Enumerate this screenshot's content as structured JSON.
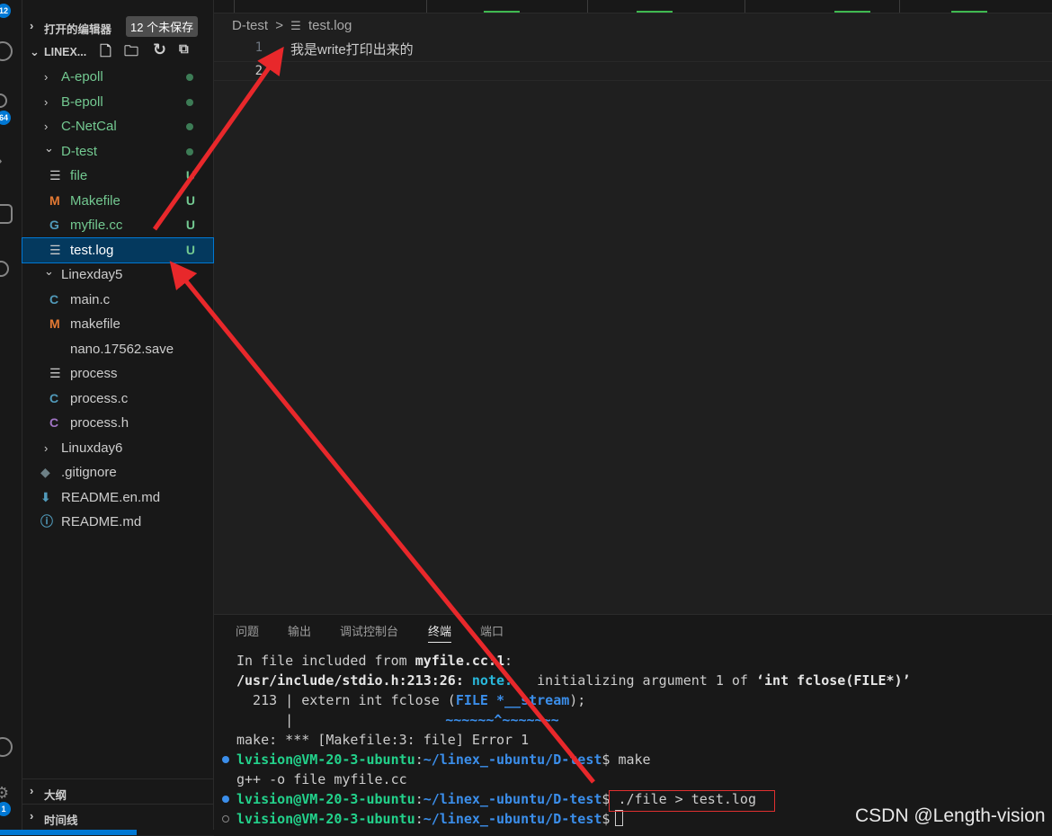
{
  "activity_bar": {
    "badges": [
      "12",
      "64",
      "1"
    ],
    "icons": [
      "files-icon",
      "search-icon",
      "source-control-icon",
      "run-debug-icon",
      "remote-explorer-icon",
      "extensions-icon",
      "account-icon",
      "settings-gear-icon"
    ]
  },
  "sidebar": {
    "open_editors_label": "打开的编辑器",
    "unsaved_badge": "12 个未保存",
    "workspace_label": "LINEX...",
    "tree": [
      {
        "label": "A-epoll",
        "kind": "folder",
        "state": "collapsed",
        "indent": 1,
        "dot": true
      },
      {
        "label": "B-epoll",
        "kind": "folder",
        "state": "collapsed",
        "indent": 1,
        "dot": true
      },
      {
        "label": "C-NetCal",
        "kind": "folder",
        "state": "collapsed",
        "indent": 1,
        "dot": true
      },
      {
        "label": "D-test",
        "kind": "folder",
        "state": "expanded",
        "indent": 1,
        "dot": true
      },
      {
        "label": "file",
        "kind": "file",
        "icon": "lines",
        "indent": 2,
        "status": "U"
      },
      {
        "label": "Makefile",
        "kind": "file",
        "icon": "M",
        "indent": 2,
        "status": "U"
      },
      {
        "label": "myfile.cc",
        "kind": "file",
        "icon": "C++",
        "indent": 2,
        "status": "U"
      },
      {
        "label": "test.log",
        "kind": "file",
        "icon": "lines",
        "indent": 2,
        "status": "U",
        "selected": true
      },
      {
        "label": "Linexday5",
        "kind": "folder",
        "state": "expanded",
        "indent": 1
      },
      {
        "label": "main.c",
        "kind": "file",
        "icon": "C",
        "indent": 2
      },
      {
        "label": "makefile",
        "kind": "file",
        "icon": "M",
        "indent": 2
      },
      {
        "label": "nano.17562.save",
        "kind": "file",
        "icon": "none",
        "indent": 2
      },
      {
        "label": "process",
        "kind": "file",
        "icon": "lines",
        "indent": 2
      },
      {
        "label": "process.c",
        "kind": "file",
        "icon": "C",
        "indent": 2
      },
      {
        "label": "process.h",
        "kind": "file",
        "icon": "H",
        "indent": 2
      },
      {
        "label": "Linuxday6",
        "kind": "folder",
        "state": "collapsed",
        "indent": 1
      },
      {
        "label": ".gitignore",
        "kind": "file",
        "icon": "git",
        "indent": 1
      },
      {
        "label": "README.en.md",
        "kind": "file",
        "icon": "download",
        "indent": 1
      },
      {
        "label": "README.md",
        "kind": "file",
        "icon": "info",
        "indent": 1
      }
    ],
    "outline_label": "大纲",
    "timeline_label": "时间线"
  },
  "editor": {
    "breadcrumb": {
      "folder": "D-test",
      "separator": ">",
      "file": "test.log"
    },
    "lines": [
      {
        "number": "1",
        "text": "我是write打印出来的"
      },
      {
        "number": "2",
        "text": ""
      }
    ]
  },
  "panel": {
    "tabs": [
      "问题",
      "输出",
      "调试控制台",
      "终端",
      "端口"
    ],
    "active_tab": "终端",
    "terminal": {
      "l1_pre": "In file included from ",
      "l1_bold": "myfile.cc:1",
      "l1_post": ":",
      "l2_loc": "/usr/include/stdio.h:213:26: ",
      "l2_note": "note: ",
      "l2_text": "  initializing argument 1 of ",
      "l2_sig": "‘int fclose(FILE*)’",
      "l3_pre": "  213 | extern int fclose (",
      "l3_hl": "FILE *__stream",
      "l3_post": ");",
      "l4_pipe": "      |",
      "l4_squiggle": "~~~~~~^~~~~~~~",
      "l5": "make: *** [Makefile:3: file] Error 1",
      "prompt_user": "lvision@VM-20-3-ubuntu",
      "prompt_path": "~/linex_-ubuntu/D-test",
      "cmd1": " make",
      "l7": "g++ -o file myfile.cc",
      "cmd2": " ./file > test.log",
      "cmd3": " "
    }
  },
  "watermark": "CSDN @Length-vision",
  "colors": {
    "accent": "#0078d4",
    "annotation_arrow": "#e8282b",
    "untracked": "#73c991",
    "terminal_green": "#23d18b",
    "terminal_blue": "#3b8eea"
  }
}
